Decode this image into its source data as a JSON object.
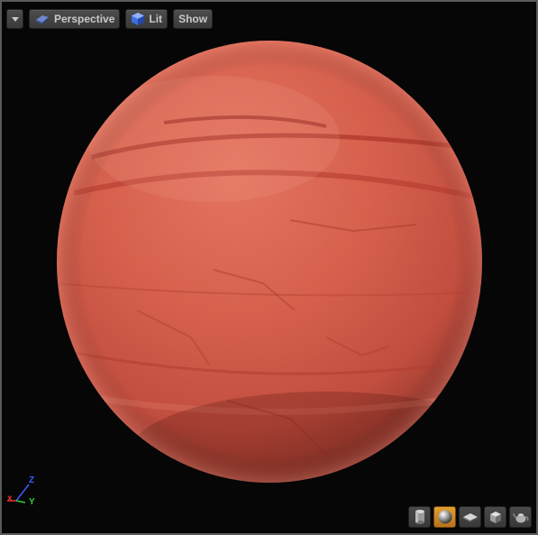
{
  "toolbar": {
    "dropdown_icon": "chevron-down-icon",
    "perspective_label": "Perspective",
    "perspective_icon": "perspective-cube-icon",
    "lit_label": "Lit",
    "lit_icon": "lit-sphere-icon",
    "show_label": "Show"
  },
  "viewport": {
    "background_color": "#060606",
    "border_color": "#5a5a5a",
    "preview_material_color": "#d25a46"
  },
  "axis_gizmo": {
    "x_label": "x",
    "y_label": "Y",
    "z_label": "Z",
    "x_color": "#e83030",
    "y_color": "#30d030",
    "z_color": "#3a5cff"
  },
  "preview_shapes": [
    {
      "name": "cylinder",
      "icon": "cylinder-icon",
      "active": false
    },
    {
      "name": "sphere",
      "icon": "sphere-icon",
      "active": true
    },
    {
      "name": "plane",
      "icon": "plane-icon",
      "active": false
    },
    {
      "name": "cube",
      "icon": "cube-icon",
      "active": false
    },
    {
      "name": "custom-mesh",
      "icon": "teapot-icon",
      "active": false
    }
  ]
}
